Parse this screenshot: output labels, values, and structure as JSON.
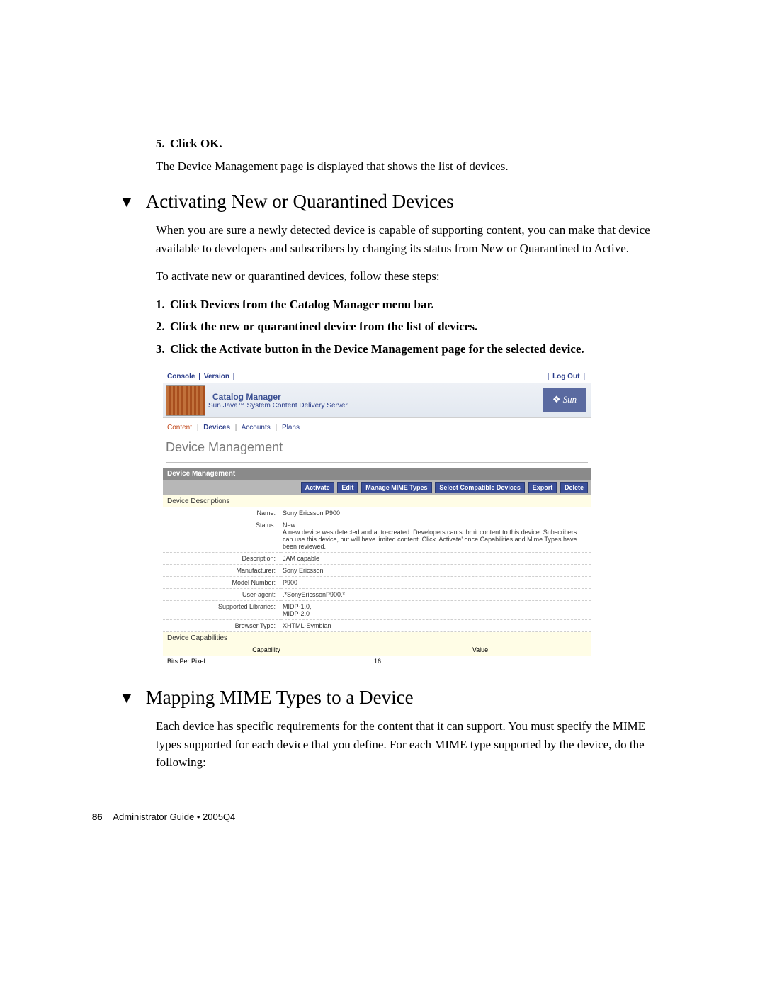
{
  "step5": {
    "num": "5.",
    "title": "Click OK.",
    "after": "The Device Management page is displayed that shows the list of devices."
  },
  "section1": {
    "heading": "Activating New or Quarantined Devices",
    "p1": "When you are sure a newly detected device is capable of supporting content, you can make that device available to developers and subscribers by changing its status from New or Quarantined to Active.",
    "p2": "To activate new or quarantined devices, follow these steps:",
    "steps": [
      {
        "num": "1.",
        "text": "Click Devices from the Catalog Manager menu bar."
      },
      {
        "num": "2.",
        "text": "Click the new or quarantined device from the list of devices."
      },
      {
        "num": "3.",
        "text": "Click the Activate button in the Device Management page for the selected device."
      }
    ]
  },
  "screenshot": {
    "topLeft": {
      "a": "Console",
      "b": "Version"
    },
    "topRight": "Log Out",
    "bannerTitle": "Catalog Manager",
    "bannerSub": "Sun Java™ System Content Delivery Server",
    "sunLabel": "Sun",
    "subnav": {
      "a": "Content",
      "b": "Devices",
      "c": "Accounts",
      "d": "Plans"
    },
    "pageTitle": "Device Management",
    "sectionBar": "Device Management",
    "buttons": [
      "Activate",
      "Edit",
      "Manage MIME Types",
      "Select Compatible Devices",
      "Export",
      "Delete"
    ],
    "descHeader": "Device Descriptions",
    "fields": [
      {
        "lbl": "Name:",
        "val": "Sony Ericsson P900"
      },
      {
        "lbl": "Status:",
        "val": "New\nA new device was detected and auto-created. Developers can submit content to this device. Subscribers can use this device, but will have limited content. Click 'Activate' once Capabilities and Mime Types have been reviewed."
      },
      {
        "lbl": "Description:",
        "val": "JAM capable"
      },
      {
        "lbl": "Manufacturer:",
        "val": "Sony Ericsson"
      },
      {
        "lbl": "Model Number:",
        "val": "P900"
      },
      {
        "lbl": "User-agent:",
        "val": ".*SonyEricssonP900.*"
      },
      {
        "lbl": "Supported Libraries:",
        "val": "MIDP-1.0,\nMIDP-2.0"
      },
      {
        "lbl": "Browser Type:",
        "val": "XHTML-Symbian"
      }
    ],
    "capsHeader": "Device Capabilities",
    "capCols": {
      "c1": "Capability",
      "c2": "Value"
    },
    "capRow": {
      "c1": "Bits Per Pixel",
      "c2": "16"
    }
  },
  "section2": {
    "heading": "Mapping MIME Types to a Device",
    "p1": "Each device has specific requirements for the content that it can support. You must specify the MIME types supported for each device that you define. For each MIME type supported by the device, do the following:"
  },
  "footer": {
    "page": "86",
    "text": "Administrator Guide • 2005Q4"
  }
}
